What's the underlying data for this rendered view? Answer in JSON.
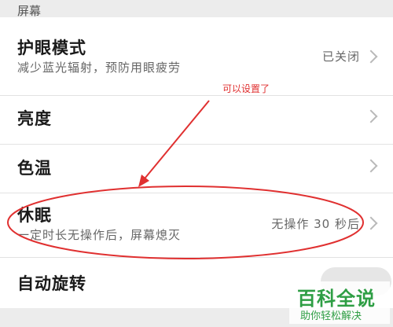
{
  "section": {
    "header": "屏幕"
  },
  "eye_protection": {
    "title": "护眼模式",
    "subtitle": "减少蓝光辐射，预防用眼疲劳",
    "value": "已关闭"
  },
  "brightness": {
    "title": "亮度"
  },
  "color_temp": {
    "title": "色温"
  },
  "sleep": {
    "title": "休眠",
    "subtitle": "一定时长无操作后，屏幕熄灭",
    "value": "无操作 30 秒后"
  },
  "auto_rotate": {
    "title": "自动旋转"
  },
  "annotation": {
    "text": "可以设置了",
    "color": "#e03030"
  },
  "watermark": {
    "logo": "百科全说",
    "tagline": "助你轻松解决",
    "color": "#2e9e44"
  }
}
